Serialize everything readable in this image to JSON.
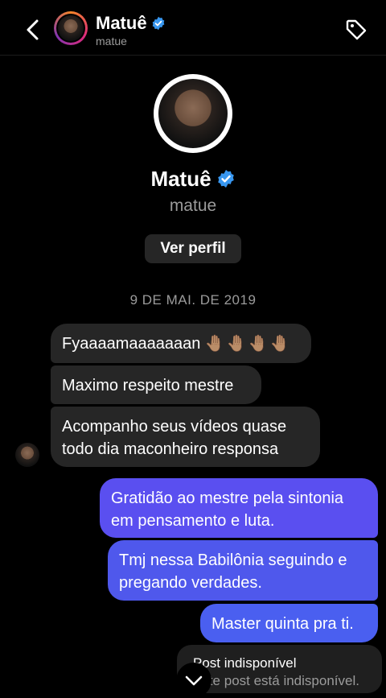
{
  "header": {
    "name": "Matuê",
    "username": "matue",
    "back_icon": "chevron-left-icon",
    "tag_icon": "tag-icon"
  },
  "profile": {
    "name": "Matuê",
    "username": "matue",
    "view_profile_label": "Ver perfil"
  },
  "thread": {
    "date": "9 DE MAI. DE 2019",
    "messages": [
      {
        "from": "them",
        "text": "Fyaaaamaaaaaaan",
        "emoji": "🤚🏽🤚🏽🤚🏽🤚🏽"
      },
      {
        "from": "them",
        "text": "Maximo respeito mestre"
      },
      {
        "from": "them",
        "text": "Acompanho seus vídeos quase todo dia maconheiro responsa"
      },
      {
        "from": "me",
        "text": "Gratidão ao mestre pela sintonia em pensamento e luta."
      },
      {
        "from": "me",
        "text": "Tmj nessa Babilônia seguindo e pregando verdades."
      },
      {
        "from": "me",
        "text": "Master quinta pra ti."
      }
    ],
    "shared_post": {
      "title": "Post indisponível",
      "subtitle": "Este post está indisponível."
    }
  },
  "colors": {
    "background": "#000000",
    "incoming_bubble": "#262626",
    "outgoing_bubble": "#4d57ef",
    "verified": "#3897f0",
    "muted_text": "#9b9b9b"
  }
}
